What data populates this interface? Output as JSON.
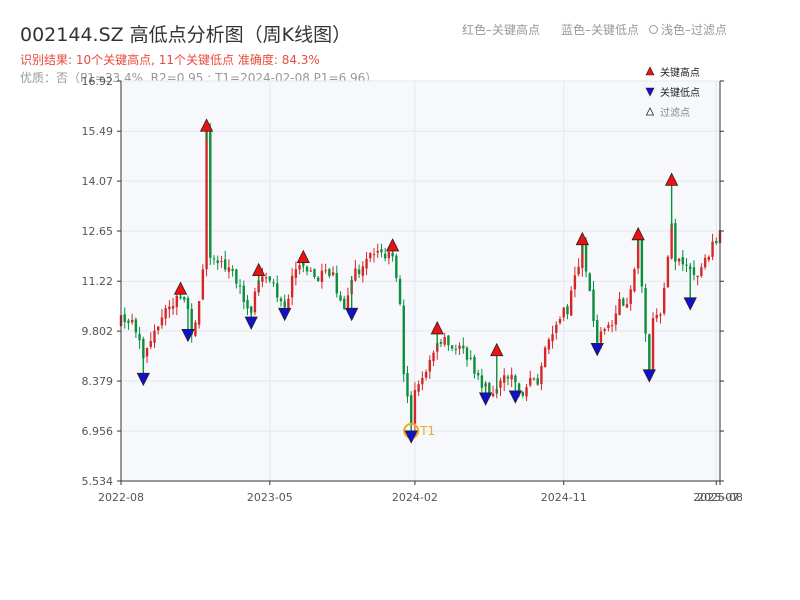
{
  "header": {
    "title": "002144.SZ 高低点分析图（周K线图）",
    "result": "识别结果: 10个关键高点, 11个关键低点  准确度: 84.3%",
    "quality": "优质：否（P1=33.4%, R2=0.95 ; T1=2024-02-08 P1=6.96）"
  },
  "top_legend": {
    "red": "红色–关键高点",
    "blue": "蓝色–关键低点",
    "light": "浅色–过滤点"
  },
  "colors": {
    "up": "#d62728",
    "down": "#0a8f3c",
    "high_marker": "#ee1111",
    "low_marker": "#1111cc",
    "t1": "#f5a623",
    "plot_bg": "#f6f8fb"
  },
  "chart_data": {
    "type": "candlestick",
    "ylim": [
      5.534,
      16.92
    ],
    "y_ticks": [
      "16.92",
      "15.49",
      "14.07",
      "12.65",
      "11.22",
      "9.802",
      "8.379",
      "6.956",
      "5.534"
    ],
    "x_ticks": [
      {
        "label": "2022-08",
        "week": 0
      },
      {
        "label": "2023-05",
        "week": 40
      },
      {
        "label": "2024-02",
        "week": 79
      },
      {
        "label": "2024-11",
        "week": 119
      },
      {
        "label": "2025-07",
        "week": 160
      },
      {
        "label": "2025-08",
        "week": 161
      }
    ],
    "week_range": [
      0,
      161
    ],
    "legend": [
      {
        "label": "关键高点",
        "kind": "high"
      },
      {
        "label": "关键低点",
        "kind": "low"
      },
      {
        "label": "过滤点",
        "kind": "filtered"
      }
    ],
    "t1_label": "T1",
    "t1": {
      "week": 78,
      "price": 6.96
    },
    "price_path": [
      [
        0,
        10.1
      ],
      [
        4,
        9.9
      ],
      [
        6,
        8.9
      ],
      [
        8,
        9.4
      ],
      [
        11,
        10.2
      ],
      [
        14,
        10.6
      ],
      [
        16,
        10.9
      ],
      [
        18,
        10.4
      ],
      [
        19,
        9.8
      ],
      [
        21,
        10.6
      ],
      [
        22,
        11.4
      ],
      [
        23,
        15.4
      ],
      [
        24,
        12.0
      ],
      [
        27,
        11.7
      ],
      [
        30,
        11.5
      ],
      [
        32,
        11.0
      ],
      [
        35,
        10.3
      ],
      [
        37,
        11.3
      ],
      [
        40,
        11.2
      ],
      [
        42,
        10.9
      ],
      [
        44,
        10.5
      ],
      [
        46,
        11.2
      ],
      [
        49,
        11.8
      ],
      [
        52,
        11.3
      ],
      [
        55,
        11.5
      ],
      [
        57,
        11.3
      ],
      [
        60,
        10.5
      ],
      [
        63,
        11.5
      ],
      [
        66,
        11.8
      ],
      [
        70,
        12.0
      ],
      [
        73,
        12.1
      ],
      [
        75,
        10.6
      ],
      [
        76,
        8.7
      ],
      [
        77,
        7.8
      ],
      [
        78,
        7.1
      ],
      [
        79,
        8.2
      ],
      [
        82,
        8.8
      ],
      [
        85,
        9.5
      ],
      [
        87,
        9.7
      ],
      [
        89,
        9.3
      ],
      [
        91,
        9.5
      ],
      [
        93,
        9.1
      ],
      [
        96,
        8.5
      ],
      [
        99,
        8.0
      ],
      [
        101,
        8.2
      ],
      [
        104,
        8.6
      ],
      [
        106,
        8.3
      ],
      [
        108,
        8.1
      ],
      [
        110,
        8.5
      ],
      [
        112,
        8.3
      ],
      [
        114,
        9.4
      ],
      [
        117,
        10.1
      ],
      [
        120,
        10.4
      ],
      [
        124,
        12.2
      ],
      [
        126,
        10.8
      ],
      [
        128,
        9.5
      ],
      [
        131,
        9.9
      ],
      [
        134,
        10.6
      ],
      [
        136,
        10.7
      ],
      [
        138,
        11.5
      ],
      [
        139,
        12.4
      ],
      [
        140,
        11.0
      ],
      [
        142,
        8.7
      ],
      [
        143,
        10.3
      ],
      [
        145,
        10.2
      ],
      [
        148,
        12.9
      ],
      [
        149,
        11.8
      ],
      [
        151,
        11.6
      ],
      [
        153,
        11.5
      ],
      [
        155,
        11.3
      ],
      [
        157,
        11.9
      ],
      [
        159,
        12.2
      ],
      [
        161,
        12.7
      ]
    ],
    "key_highs": [
      {
        "week": 16,
        "price": 10.85
      },
      {
        "week": 23,
        "price": 15.49
      },
      {
        "week": 37,
        "price": 11.38
      },
      {
        "week": 49,
        "price": 11.75
      },
      {
        "week": 73,
        "price": 12.08
      },
      {
        "week": 85,
        "price": 9.72
      },
      {
        "week": 101,
        "price": 9.1
      },
      {
        "week": 124,
        "price": 12.26
      },
      {
        "week": 139,
        "price": 12.4
      },
      {
        "week": 148,
        "price": 13.95
      }
    ],
    "key_lows": [
      {
        "week": 6,
        "price": 8.6
      },
      {
        "week": 18,
        "price": 9.85
      },
      {
        "week": 35,
        "price": 10.2
      },
      {
        "week": 44,
        "price": 10.45
      },
      {
        "week": 62,
        "price": 10.45
      },
      {
        "week": 78,
        "price": 6.96
      },
      {
        "week": 98,
        "price": 8.04
      },
      {
        "week": 106,
        "price": 8.1
      },
      {
        "week": 128,
        "price": 9.45
      },
      {
        "week": 142,
        "price": 8.7
      },
      {
        "week": 153,
        "price": 10.75
      }
    ]
  }
}
